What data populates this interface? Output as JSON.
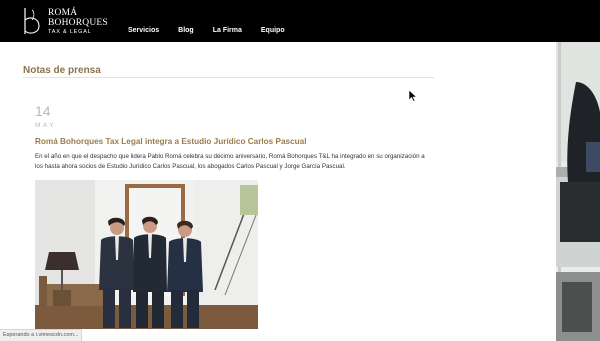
{
  "header": {
    "logo_line1": "ROMÁ",
    "logo_line2": "BOHORQUES",
    "logo_line3": "TAX & LEGAL",
    "nav": [
      "Servicios",
      "Blog",
      "La Firma",
      "Equipo"
    ]
  },
  "main": {
    "section_title": "Notas de prensa",
    "article": {
      "day": "14",
      "month": "MAY",
      "title": "Romá Bohorques Tax Legal integra a Estudio Jurídico Carlos Pascual",
      "text": "En el año en que el despacho que lidera Pablo Romá celebra su décimo aniversario, Romá Bohorques T&L ha integrado en su organización a los hasta ahora socios de Estudio Jurídico Carlos Pascual, los abogados Carlos Pascual y Jorge García Pascual."
    }
  },
  "status_bar": {
    "text": "Esperando a i.vimeocdn.com..."
  }
}
